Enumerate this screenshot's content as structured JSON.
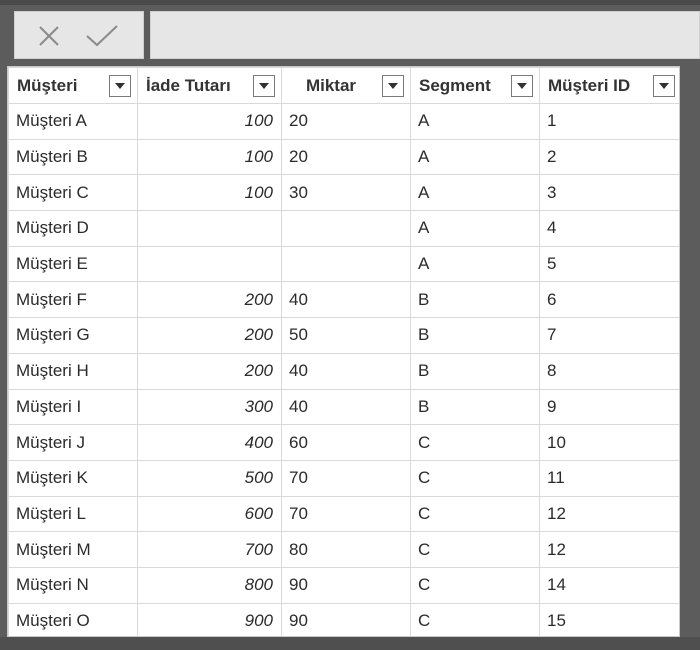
{
  "toolbar": {
    "cancel_icon": "close-icon",
    "confirm_icon": "check-icon",
    "formula_text": ""
  },
  "table": {
    "columns": [
      {
        "label": "Müşteri"
      },
      {
        "label": "İade Tutarı"
      },
      {
        "label": "Miktar"
      },
      {
        "label": "Segment"
      },
      {
        "label": "Müşteri ID"
      }
    ],
    "rows": [
      [
        "Müşteri A",
        "100",
        "20",
        "A",
        "1"
      ],
      [
        "Müşteri B",
        "100",
        "20",
        "A",
        "2"
      ],
      [
        "Müşteri C",
        "100",
        "30",
        "A",
        "3"
      ],
      [
        "Müşteri D",
        "",
        "",
        "A",
        "4"
      ],
      [
        "Müşteri E",
        "",
        "",
        "A",
        "5"
      ],
      [
        "Müşteri F",
        "200",
        "40",
        "B",
        "6"
      ],
      [
        "Müşteri G",
        "200",
        "50",
        "B",
        "7"
      ],
      [
        "Müşteri H",
        "200",
        "40",
        "B",
        "8"
      ],
      [
        "Müşteri I",
        "300",
        "40",
        "B",
        "9"
      ],
      [
        "Müşteri J",
        "400",
        "60",
        "C",
        "10"
      ],
      [
        "Müşteri K",
        "500",
        "70",
        "C",
        "11"
      ],
      [
        "Müşteri L",
        "600",
        "70",
        "C",
        "12"
      ],
      [
        "Müşteri M",
        "700",
        "80",
        "C",
        "12"
      ],
      [
        "Müşteri N",
        "800",
        "90",
        "C",
        "14"
      ],
      [
        "Müşteri O",
        "900",
        "90",
        "C",
        "15"
      ]
    ]
  },
  "colors": {
    "background": "#5c5c5c",
    "toolbar_box": "#e6e6e6",
    "grid_line": "#d9d9d9",
    "text": "#2b2b2b"
  }
}
